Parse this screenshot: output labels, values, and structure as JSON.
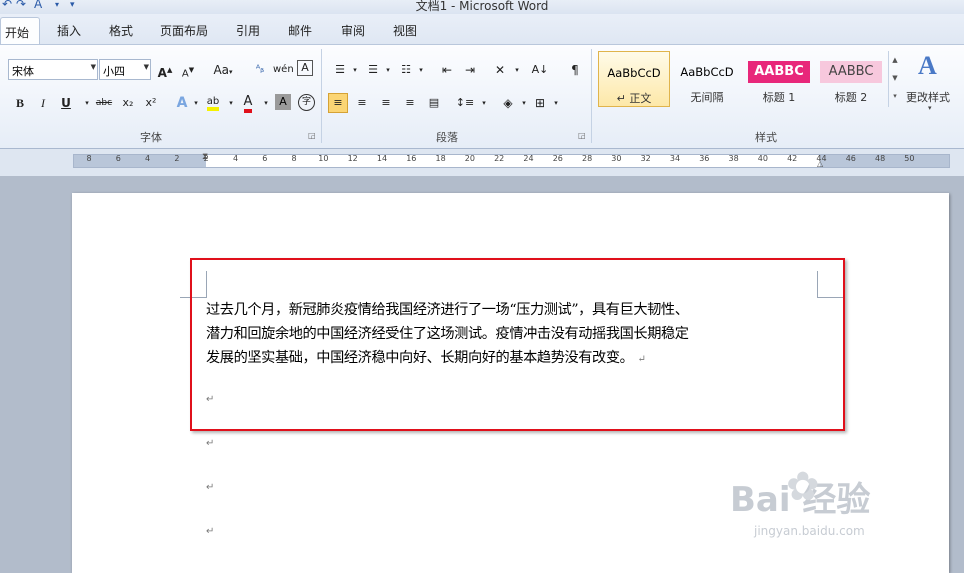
{
  "window": {
    "title": "文档1 - Microsoft Word"
  },
  "tabs": [
    {
      "label": "开始",
      "active": true
    },
    {
      "label": "插入"
    },
    {
      "label": "格式"
    },
    {
      "label": "页面布局"
    },
    {
      "label": "引用"
    },
    {
      "label": "邮件"
    },
    {
      "label": "审阅"
    },
    {
      "label": "视图"
    }
  ],
  "font": {
    "name_value": "宋体",
    "size_value": "小四",
    "group_label": "字体",
    "buttons": {
      "bold": "B",
      "italic": "I",
      "underline": "U",
      "strike": "abc",
      "subscript": "x₂",
      "superscript": "x²",
      "grow": "A",
      "shrink": "A",
      "change_case": "Aa",
      "font_color": "A",
      "char_shading": "A",
      "enclose": "字"
    }
  },
  "paragraph": {
    "group_label": "段落"
  },
  "styles": {
    "group_label": "样式",
    "items": [
      {
        "sample": "AaBbCcD",
        "name": "↵ 正文"
      },
      {
        "sample": "AaBbCcD",
        "name": "无间隔"
      },
      {
        "sample": "AABBC",
        "name": "标题 1"
      },
      {
        "sample": "AABBC",
        "name": "标题 2"
      }
    ],
    "change_styles_label": "更改样式"
  },
  "ruler": {
    "labels": [
      "8",
      "6",
      "4",
      "2",
      "2",
      "4",
      "6",
      "8",
      "10",
      "12",
      "14",
      "16",
      "18",
      "20",
      "22",
      "24",
      "26",
      "28",
      "30",
      "32",
      "34",
      "36",
      "38",
      "40",
      "42",
      "44",
      "46",
      "48",
      "50"
    ]
  },
  "document": {
    "paragraph_lines": [
      "过去几个月，新冠肺炎疫情给我国经济进行了一场“压力测试”，具有巨大韧性、",
      "潜力和回旋余地的中国经济经受住了这场测试。疫情冲击没有动摇我国长期稳定",
      "发展的坚实基础，中国经济稳中向好、长期向好的基本趋势没有改变。"
    ],
    "paragraph_mark": "↵"
  },
  "watermark": {
    "brand": "Bai  经验",
    "url": "jingyan.baidu.com"
  },
  "colors": {
    "highlight_border": "#e0101b",
    "title1_bg": "#e8277a",
    "title2_bg": "#f7c8dd",
    "selected_button": "#fbd574"
  }
}
